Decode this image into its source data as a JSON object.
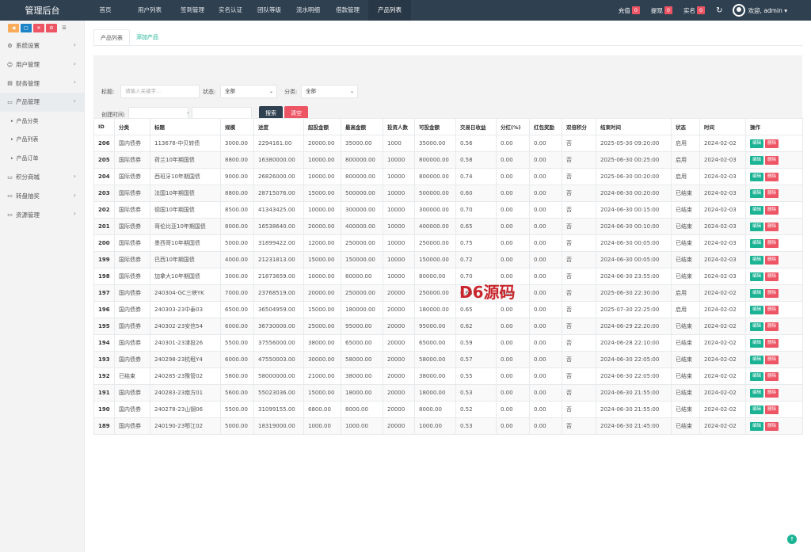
{
  "app": {
    "title": "管理后台"
  },
  "topnav": [
    {
      "label": "首页",
      "active": false
    },
    {
      "label": "用户列表",
      "active": false
    },
    {
      "label": "签到管理",
      "active": false
    },
    {
      "label": "实名认证",
      "active": false
    },
    {
      "label": "团队等级",
      "active": false
    },
    {
      "label": "流水明细",
      "active": false
    },
    {
      "label": "借款管理",
      "active": false
    },
    {
      "label": "产品列表",
      "active": true
    }
  ],
  "topright": {
    "recharge": {
      "label": "充值",
      "count": "0"
    },
    "withdraw": {
      "label": "提现",
      "count": "0"
    },
    "realname": {
      "label": "实名",
      "count": "0"
    },
    "welcome": "欢迎, admin"
  },
  "sidebar": {
    "menus": [
      {
        "label": "系统设置",
        "icon": "gear-icon"
      },
      {
        "label": "用户管理",
        "icon": "user-icon"
      },
      {
        "label": "财务管理",
        "icon": "finance-icon"
      },
      {
        "label": "产品管理",
        "icon": "monitor-icon",
        "open": true
      },
      {
        "label": "积分商城",
        "icon": "monitor-icon"
      },
      {
        "label": "转盘抽奖",
        "icon": "monitor-icon"
      },
      {
        "label": "资源管理",
        "icon": "monitor-icon"
      }
    ],
    "submenus": [
      "产品分类",
      "产品列表",
      "产品订单"
    ]
  },
  "tabs": [
    "产品列表",
    "添加产品"
  ],
  "filters": {
    "title_label": "标题:",
    "title_placeholder": "请输入关键字...",
    "status_label": "状态:",
    "status_value": "全部",
    "category_label": "分类:",
    "category_value": "全部",
    "created_label": "创建时间:",
    "date_sep": "-",
    "search_button": "搜索",
    "clear_button": "清空"
  },
  "table": {
    "headers": [
      "ID",
      "分类",
      "标题",
      "规模",
      "进度",
      "起投金额",
      "最高金额",
      "投资人数",
      "可投金额",
      "交易日收益",
      "分红(%)",
      "红包奖励",
      "双倍积分",
      "结束时间",
      "状态",
      "时间",
      "操作"
    ],
    "rows": [
      [
        "206",
        "国内债券",
        "113678-中贝转债",
        "3000.00",
        "2294161.00",
        "20000.00",
        "35000.00",
        "1000",
        "35000.00",
        "0.56",
        "0.00",
        "0.00",
        "否",
        "2025-05-30 09:20:00",
        "启用",
        "2024-02-02"
      ],
      [
        "205",
        "国际债券",
        "荷兰10年期国债",
        "8800.00",
        "16380000.00",
        "10000.00",
        "800000.00",
        "10000",
        "800000.00",
        "0.58",
        "0.00",
        "0.00",
        "否",
        "2025-06-30 00:25:00",
        "启用",
        "2024-02-03"
      ],
      [
        "204",
        "国际债券",
        "西班牙10年期国债",
        "9000.00",
        "26826000.00",
        "10000.00",
        "800000.00",
        "10000",
        "800000.00",
        "0.74",
        "0.00",
        "0.00",
        "否",
        "2025-06-30 00:20:00",
        "启用",
        "2024-02-03"
      ],
      [
        "203",
        "国际债券",
        "法国10年期国债",
        "8800.00",
        "28715076.00",
        "15000.00",
        "500000.00",
        "10000",
        "500000.00",
        "0.60",
        "0.00",
        "0.00",
        "否",
        "2024-06-30 00:20:00",
        "已结束",
        "2024-02-03"
      ],
      [
        "202",
        "国际债券",
        "德国10年期国债",
        "8500.00",
        "41343425.00",
        "10000.00",
        "300000.00",
        "10000",
        "300000.00",
        "0.70",
        "0.00",
        "0.00",
        "否",
        "2024-06-30 00:15:00",
        "已结束",
        "2024-02-03"
      ],
      [
        "201",
        "国际债券",
        "哥伦比亚10年期国债",
        "8000.00",
        "16538640.00",
        "20000.00",
        "400000.00",
        "10000",
        "400000.00",
        "0.65",
        "0.00",
        "0.00",
        "否",
        "2024-06-30 00:10:00",
        "已结束",
        "2024-02-03"
      ],
      [
        "200",
        "国际债券",
        "墨西哥10年期国债",
        "5000.00",
        "31899422.00",
        "12000.00",
        "250000.00",
        "10000",
        "250000.00",
        "0.75",
        "0.00",
        "0.00",
        "否",
        "2024-06-30 00:05:00",
        "已结束",
        "2024-02-03"
      ],
      [
        "199",
        "国际债券",
        "巴西10年期国债",
        "4000.00",
        "21231813.00",
        "15000.00",
        "150000.00",
        "10000",
        "150000.00",
        "0.72",
        "0.00",
        "0.00",
        "否",
        "2024-06-30 00:05:00",
        "已结束",
        "2024-02-03"
      ],
      [
        "198",
        "国际债券",
        "加拿大10年期国债",
        "3000.00",
        "21873659.00",
        "10000.00",
        "80000.00",
        "10000",
        "80000.00",
        "0.70",
        "0.00",
        "0.00",
        "否",
        "2024-06-30 23:55:00",
        "已结束",
        "2024-02-03"
      ],
      [
        "197",
        "国内债券",
        "240304-GC三峡YK",
        "7000.00",
        "23768519.00",
        "20000.00",
        "250000.00",
        "20000",
        "250000.00",
        "0.68",
        "0.00",
        "0.00",
        "否",
        "2025-06-30 22:30:00",
        "启用",
        "2024-02-02"
      ],
      [
        "196",
        "国内债券",
        "240303-23中泰03",
        "6500.00",
        "36504959.00",
        "15000.00",
        "180000.00",
        "20000",
        "180000.00",
        "0.65",
        "0.00",
        "0.00",
        "否",
        "2025-07-30 22:25:00",
        "启用",
        "2024-02-02"
      ],
      [
        "195",
        "国内债券",
        "240302-23安信54",
        "6000.00",
        "36730000.00",
        "25000.00",
        "95000.00",
        "20000",
        "95000.00",
        "0.62",
        "0.00",
        "0.00",
        "否",
        "2024-06-29 22:20:00",
        "已结束",
        "2024-02-02"
      ],
      [
        "194",
        "国内债券",
        "240301-23津投26",
        "5500.00",
        "37556000.00",
        "38000.00",
        "65000.00",
        "20000",
        "65000.00",
        "0.59",
        "0.00",
        "0.00",
        "否",
        "2024-06-28 22:10:00",
        "已结束",
        "2024-02-02"
      ],
      [
        "193",
        "国内债券",
        "240298-23杭租Y4",
        "6000.00",
        "47550003.00",
        "30000.00",
        "58000.00",
        "20000",
        "58000.00",
        "0.57",
        "0.00",
        "0.00",
        "否",
        "2024-06-30 22:05:00",
        "已结束",
        "2024-02-02"
      ],
      [
        "192",
        "已结束",
        "240285-23豫管02",
        "5800.00",
        "58000000.00",
        "21000.00",
        "38000.00",
        "20000",
        "38000.00",
        "0.55",
        "0.00",
        "0.00",
        "否",
        "2024-06-30 22:05:00",
        "已结束",
        "2024-02-02"
      ],
      [
        "191",
        "国内债券",
        "240283-23南方01",
        "5600.00",
        "55023036.00",
        "15000.00",
        "18000.00",
        "20000",
        "18000.00",
        "0.53",
        "0.00",
        "0.00",
        "否",
        "2024-06-30 21:55:00",
        "已结束",
        "2024-02-02"
      ],
      [
        "190",
        "国内债券",
        "240278-23山钢06",
        "5500.00",
        "31099155.00",
        "6800.00",
        "8000.00",
        "20000",
        "8000.00",
        "0.52",
        "0.00",
        "0.00",
        "否",
        "2024-06-30 21:55:00",
        "已结束",
        "2024-02-02"
      ],
      [
        "189",
        "国内债券",
        "240190-23鄂江02",
        "5000.00",
        "18319000.00",
        "1000.00",
        "1000.00",
        "20000",
        "1000.00",
        "0.53",
        "0.00",
        "0.00",
        "否",
        "2024-06-30 21:45:00",
        "已结束",
        "2024-02-02"
      ]
    ],
    "edit_label": "编辑",
    "delete_label": "删除"
  },
  "watermark": "D6源码",
  "colors": {
    "topbar": "#2f4050",
    "accent": "#1ab394",
    "danger": "#ed5565",
    "search_button": "#2f4050"
  }
}
